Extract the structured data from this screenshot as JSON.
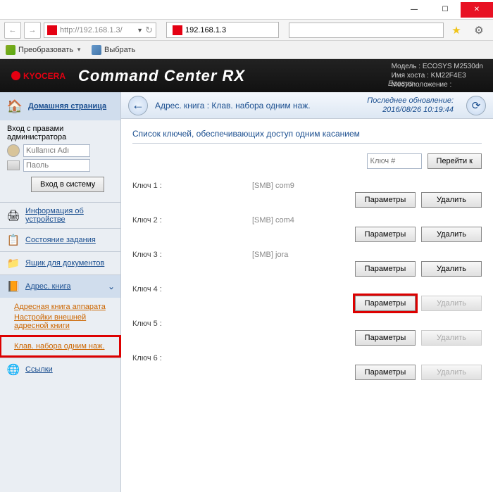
{
  "window": {
    "min": "—",
    "max": "☐",
    "close": "✕"
  },
  "addr": {
    "url": "http://192.168.1.3/"
  },
  "tab": {
    "label": "192.168.1.3"
  },
  "fav": {
    "convert": "Преобразовать",
    "select": "Выбрать"
  },
  "brand": {
    "logo": "KYOCERA",
    "title": "Command Center RX",
    "ecosys": "Ecosys·"
  },
  "meta": {
    "model_label": "Модель :",
    "model": "ECOSYS M2530dn",
    "host_label": "Имя хоста :",
    "host": "KM22F4E3",
    "loc_label": "Местоположение :"
  },
  "side": {
    "home": "Домашняя страница",
    "auth_title": "Вход с правами администратора",
    "user_ph": "Kullanıcı Adı",
    "pass_ph": "Паоль",
    "login": "Вход в систему",
    "items": [
      {
        "label": "Информация об устройстве"
      },
      {
        "label": "Состояние задания"
      },
      {
        "label": "Ящик для документов"
      },
      {
        "label": "Адрес. книга"
      },
      {
        "label": "Ссылки"
      }
    ],
    "subs": [
      "Адресная книга аппарата",
      "Настройки внешней адресной книги",
      "Клав. набора одним наж."
    ]
  },
  "content": {
    "crumb": "Адрес. книга : Клав. набора одним наж.",
    "updated_label": "Последнее обновление:",
    "updated_time": "2016/08/26 10:19:44",
    "list_title": "Список ключей, обеспечивающих доступ одним касанием",
    "key_ph": "Ключ #",
    "goto": "Перейти к",
    "keys": [
      {
        "label": "Ключ 1 :",
        "value": "[SMB] com9",
        "has_delete": true,
        "hilite": false
      },
      {
        "label": "Ключ 2 :",
        "value": "[SMB] com4",
        "has_delete": true,
        "hilite": false
      },
      {
        "label": "Ключ 3 :",
        "value": "[SMB] jora",
        "has_delete": true,
        "hilite": false
      },
      {
        "label": "Ключ 4 :",
        "value": "",
        "has_delete": false,
        "hilite": true
      },
      {
        "label": "Ключ 5 :",
        "value": "",
        "has_delete": false,
        "hilite": false
      },
      {
        "label": "Ключ 6 :",
        "value": "",
        "has_delete": false,
        "hilite": false
      }
    ],
    "params": "Параметры",
    "delete": "Удалить"
  }
}
